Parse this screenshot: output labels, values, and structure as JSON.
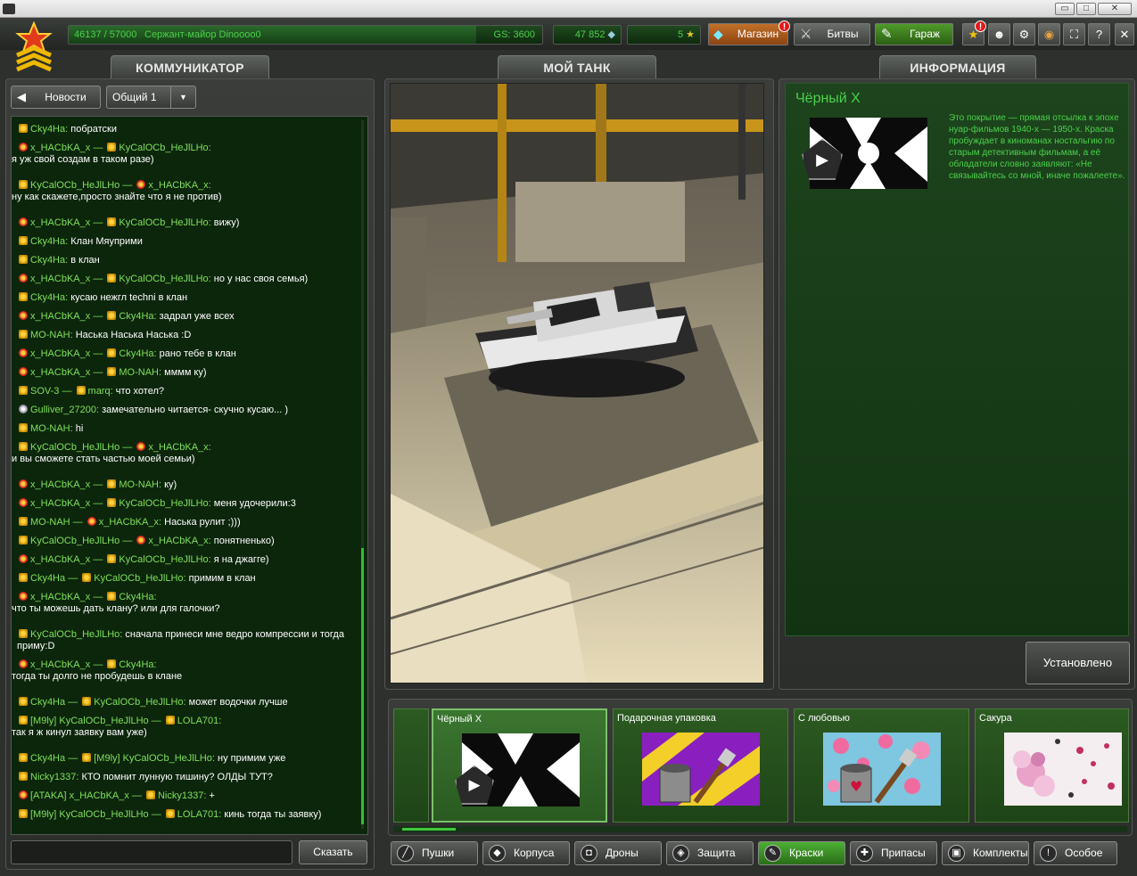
{
  "window": {
    "min": "▭",
    "max": "□",
    "close": "✕"
  },
  "topbar": {
    "xp": "46137 / 57000",
    "rank_name": "Сержант-майор Dinoooo0",
    "gs": "GS: 3600",
    "crystals": "47 852",
    "stars": "5",
    "shop": "Магазин",
    "battles": "Битвы",
    "garage": "Гараж",
    "badge": "!",
    "help": "?"
  },
  "communicator": {
    "title": "КОММУНИКАТОР",
    "news_button": "Новости",
    "channel": "Общий 1",
    "say_button": "Сказать",
    "messages": [
      {
        "from": "Cky4Ha",
        "to": "",
        "text": "побратски"
      },
      {
        "from": "x_HACbKA_x",
        "to": "KyCalOCb_HeJlLHo",
        "text": "я уж свой создам в таком разе)"
      },
      {
        "from": "KyCalOCb_HeJlLHo",
        "to": "x_HACbKA_x",
        "text": "ну как скажете,просто знайте что я не против)"
      },
      {
        "from": "x_HACbKA_x",
        "to": "KyCalOCb_HeJlLHo",
        "text": "вижу)"
      },
      {
        "from": "Cky4Ha",
        "to": "",
        "text": "Клан Мяуприми"
      },
      {
        "from": "Cky4Ha",
        "to": "",
        "text": "в клан"
      },
      {
        "from": "x_HACbKA_x",
        "to": "KyCalOCb_HeJlLHo",
        "text": "но у нас своя семья)"
      },
      {
        "from": "Cky4Ha",
        "to": "",
        "text": "кусаю нежгл techni в клан"
      },
      {
        "from": "x_HACbKA_x",
        "to": "Cky4Ha",
        "text": "задрал уже всех"
      },
      {
        "from": "MO-NAH",
        "to": "",
        "text": "Наська Наська Наська :D"
      },
      {
        "from": "x_HACbKA_x",
        "to": "Cky4Ha",
        "text": "рано тебе в клан"
      },
      {
        "from": "x_HACbKA_x",
        "to": "MO-NAH",
        "text": "мммм ку)"
      },
      {
        "from": "SOV-3",
        "to": "marq",
        "text": "что хотел?"
      },
      {
        "from": "Gulliver_27200",
        "to": "",
        "text": "замечательно читается- скучно кусаю... )"
      },
      {
        "from": "MO-NAH",
        "to": "",
        "text": "hi"
      },
      {
        "from": "KyCalOCb_HeJlLHo",
        "to": "x_HACbKA_x",
        "text": "и вы сможете стать частью моей семьи)"
      },
      {
        "from": "x_HACbKA_x",
        "to": "MO-NAH",
        "text": "ку)"
      },
      {
        "from": "x_HACbKA_x",
        "to": "KyCalOCb_HeJlLHo",
        "text": "меня удочерили:3"
      },
      {
        "from": "MO-NAH",
        "to": "x_HACbKA_x",
        "text": "Наська рулит ;)))"
      },
      {
        "from": "KyCalOCb_HeJlLHo",
        "to": "x_HACbKA_x",
        "text": "понятненько)"
      },
      {
        "from": "x_HACbKA_x",
        "to": "KyCalOCb_HeJlLHo",
        "text": "я на джагге)"
      },
      {
        "from": "Cky4Ha",
        "to": "KyCalOCb_HeJlLHo",
        "text": "примим в клан"
      },
      {
        "from": "x_HACbKA_x",
        "to": "Cky4Ha",
        "text": "что ты можешь дать клану? или для галочки?"
      },
      {
        "from": "KyCalOCb_HeJlLHo",
        "to": "",
        "text": "сначала принеси мне ведро компрессии и тогда приму:D"
      },
      {
        "from": "x_HACbKA_x",
        "to": "Cky4Ha",
        "text": "тогда ты долго не пробудешь в клане"
      },
      {
        "from": "Cky4Ha",
        "to": "KyCalOCb_HeJlLHo",
        "text": "может водочки лучше"
      },
      {
        "from": "[M9ly] KyCalOCb_HeJlLHo",
        "to": "LOLA701",
        "text": "так я ж кинул заявку вам уже)"
      },
      {
        "from": "Cky4Ha",
        "to": "[M9ly] KyCalOCb_HeJlLHo",
        "text": "ну примим уже"
      },
      {
        "from": "Nicky1337",
        "to": "",
        "text": "КТО помнит лунную тишину? ОЛДЫ ТУТ?"
      },
      {
        "from": "[ATAKA] x_HACbKA_x",
        "to": "Nicky1337",
        "text": "+"
      },
      {
        "from": "[M9ly] KyCalOCb_HeJlLHo",
        "to": "LOLA701",
        "text": "кинь тогда ты заявку)"
      }
    ]
  },
  "tank": {
    "title": "МОЙ ТАНК"
  },
  "info": {
    "title": "ИНФОРМАЦИЯ",
    "item_name": "Чёрный X",
    "description": "Это покрытие — прямая отсылка к эпохе нуар-фильмов 1940-х — 1950-х. Краска пробуждает в киноманах ностальгию по старым детективным фильмам, а её обладатели словно заявляют: «Не связывайтесь со мной, иначе пожалеете».",
    "installed": "Установлено"
  },
  "items": [
    {
      "name": "Чёрный X",
      "selected": true
    },
    {
      "name": "Подарочная упаковка",
      "selected": false
    },
    {
      "name": "С любовью",
      "selected": false
    },
    {
      "name": "Сакура",
      "selected": false
    }
  ],
  "categories": [
    {
      "label": "Пушки",
      "icon": "cannon-icon",
      "glyph": "╱"
    },
    {
      "label": "Корпуса",
      "icon": "hull-icon",
      "glyph": "◆"
    },
    {
      "label": "Дроны",
      "icon": "drone-icon",
      "glyph": "◘"
    },
    {
      "label": "Защита",
      "icon": "shield-icon",
      "glyph": "◈"
    },
    {
      "label": "Краски",
      "icon": "paint-brush-icon",
      "glyph": "✎"
    },
    {
      "label": "Припасы",
      "icon": "supplies-icon",
      "glyph": "✚"
    },
    {
      "label": "Комплекты",
      "icon": "kit-icon",
      "glyph": "▣"
    },
    {
      "label": "Особое",
      "icon": "special-icon",
      "glyph": "!"
    }
  ],
  "colors": {
    "accent_green": "#4bd14b",
    "shop_orange": "#c2702a",
    "garage_green": "#4f9a2b",
    "alert_red": "#e21a1a"
  }
}
